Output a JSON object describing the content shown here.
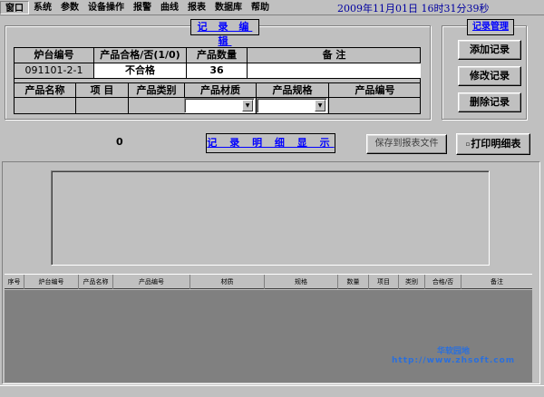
{
  "menu": {
    "items": [
      "窗口",
      "系统",
      "参数",
      "设备操作",
      "报警",
      "曲线",
      "报表",
      "数据库",
      "帮助"
    ],
    "clock": "2009年11月01日  16时31分39秒"
  },
  "edit": {
    "title": "记 录 编 辑",
    "headers1": [
      "炉台编号",
      "产品合格/否(1/0)",
      "产品数量",
      "备    注"
    ],
    "values1": [
      "091101-2-1",
      "不合格",
      "36",
      ""
    ],
    "headers2": [
      "产品名称",
      "项    目",
      "产品类别",
      "产品材质",
      "产品规格",
      "产品编号"
    ]
  },
  "mgmt": {
    "title": "记录管理",
    "add": "添加记录",
    "modify": "修改记录",
    "delete": "删除记录"
  },
  "count": "0",
  "detail_title": "记 录 明 细 显 示",
  "buttons": {
    "save": "保存到报表文件",
    "print": "打印明细表"
  },
  "list": {
    "columns": [
      "序号",
      "炉台编号",
      "产品名称",
      "产品编号",
      "材质",
      "规格",
      "数量",
      "项目",
      "类别",
      "合格/否",
      "备注"
    ]
  },
  "watermark": {
    "line1": "华软园地",
    "line2": "http://www.zhsoft.com"
  }
}
